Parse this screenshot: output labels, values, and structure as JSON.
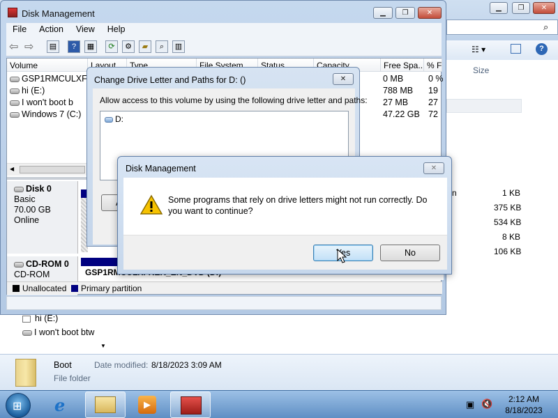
{
  "explorer": {
    "size_header": "Size",
    "sizes": [
      "1 KB",
      "375 KB",
      "534 KB",
      "8 KB",
      "106 KB"
    ],
    "partial_text": "n",
    "nav_items": [
      "hi (E:)",
      "I won't boot btw"
    ],
    "details": {
      "name": "Boot",
      "date_label": "Date modified:",
      "date_value": "8/18/2023 3:09 AM",
      "type": "File folder"
    }
  },
  "disk_mgmt": {
    "title": "Disk Management",
    "menu": [
      "File",
      "Action",
      "View",
      "Help"
    ],
    "columns": [
      "Volume",
      "Layout",
      "Type",
      "File System",
      "Status",
      "Capacity",
      "Free Spa...",
      "% F"
    ],
    "volumes": [
      {
        "name": "GSP1RMCULXFRE",
        "free": "0 MB",
        "pct": "0 %"
      },
      {
        "name": "hi (E:)",
        "free": "788 MB",
        "pct": "19"
      },
      {
        "name": "I won't boot b",
        "free": "27 MB",
        "pct": "27"
      },
      {
        "name": "Windows 7 (C:)",
        "free": "47.22 GB",
        "pct": "72"
      }
    ],
    "disk0": {
      "name": "Disk 0",
      "type": "Basic",
      "size": "70.00 GB",
      "state": "Online"
    },
    "cdrom0": {
      "name": "CD-ROM 0",
      "type": "CD-ROM",
      "volume": "GSP1RMCULXFRER_EN_DVD (D:)"
    },
    "legend": {
      "unallocated": "Unallocated",
      "primary": "Primary partition"
    },
    "colors": {
      "unallocated": "#000000",
      "primary": "#000080"
    }
  },
  "change_dialog": {
    "title": "Change Drive Letter and Paths for D: ()",
    "label": "Allow access to this volume by using the following drive letter and paths:",
    "items": [
      "D:"
    ],
    "partial_btn": "A"
  },
  "confirm_dialog": {
    "title": "Disk Management",
    "message": "Some programs that rely on drive letters might not run correctly. Do you want to continue?",
    "yes": "Yes",
    "no": "No"
  },
  "taskbar": {
    "time": "2:12 AM",
    "date": "8/18/2023"
  }
}
